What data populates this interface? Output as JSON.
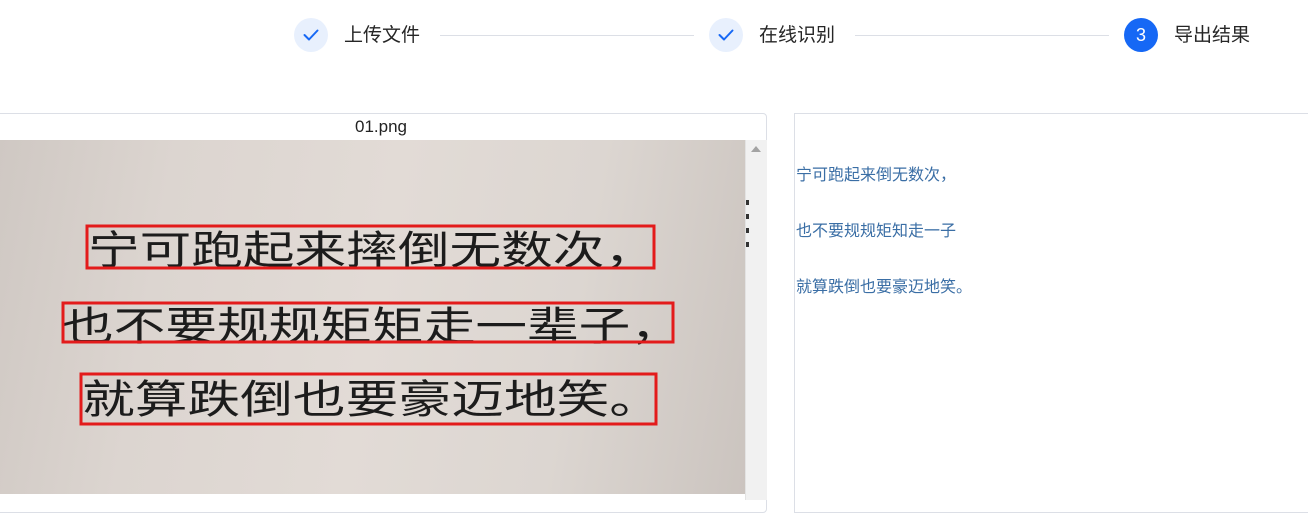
{
  "steps": [
    {
      "label": "上传文件",
      "status": "done",
      "icon": "check-icon"
    },
    {
      "label": "在线识别",
      "status": "done",
      "icon": "check-icon"
    },
    {
      "label": "导出结果",
      "status": "active",
      "number": "3"
    }
  ],
  "file": {
    "name": "01.png",
    "handwritten_lines": [
      "宁可跑起来摔倒无数次，",
      "也不要规规矩矩走一辈子，",
      "就算跌倒也要豪迈地笑。"
    ]
  },
  "result": {
    "lines": [
      "宁可跑起来倒无数次，",
      "也不要规规矩知走一子",
      "就算跌倒也要豪迈地笑。"
    ]
  },
  "colors": {
    "accent": "#1668f5",
    "done_circle": "#e8f0fd",
    "detection_box": "#e31b1b",
    "result_text": "#3a6ea5"
  }
}
